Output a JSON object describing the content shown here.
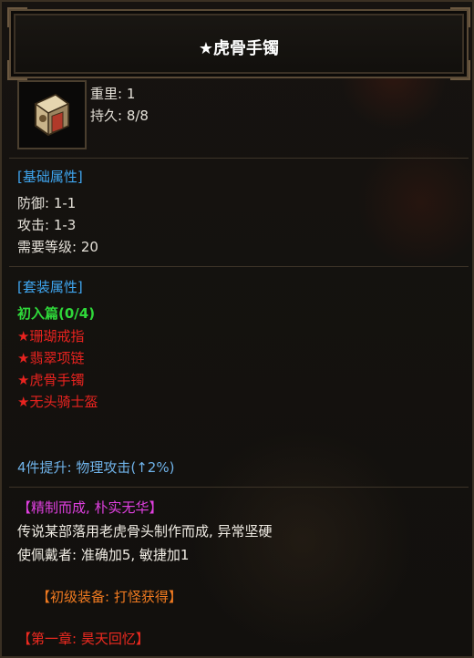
{
  "title": "★虎骨手镯",
  "item": {
    "icon": "bracelet-icon",
    "weight": "重里: 1",
    "durability": "持久: 8/8"
  },
  "basic": {
    "header": "[基础属性]",
    "defense": "防御: 1-1",
    "attack": "攻击: 1-3",
    "level": "需要等级: 20"
  },
  "set": {
    "header": "[套装属性]",
    "name": "初入篇(0/4)",
    "pieces": [
      "★珊瑚戒指",
      "★翡翠项链",
      "★虎骨手镯",
      "★无头骑士盔"
    ],
    "bonus": "4件提升: 物理攻击(↑2%)"
  },
  "lore": {
    "quote": "【精制而成, 朴实无华】",
    "line1": "传说某部落用老虎骨头制作而成, 异常坚硬",
    "line2": "使佩戴者: 准确加5, 敏捷加1"
  },
  "source": "【初级装备: 打怪获得】",
  "chapter": "【第一章: 昊天回忆】",
  "colors": {
    "section": "#3fa6f0",
    "set_name": "#2fd83a",
    "set_piece": "#e8231f",
    "bonus": "#6fb2e8",
    "quote": "#e040e0",
    "source": "#f07a20",
    "chapter": "#ee2a20"
  }
}
